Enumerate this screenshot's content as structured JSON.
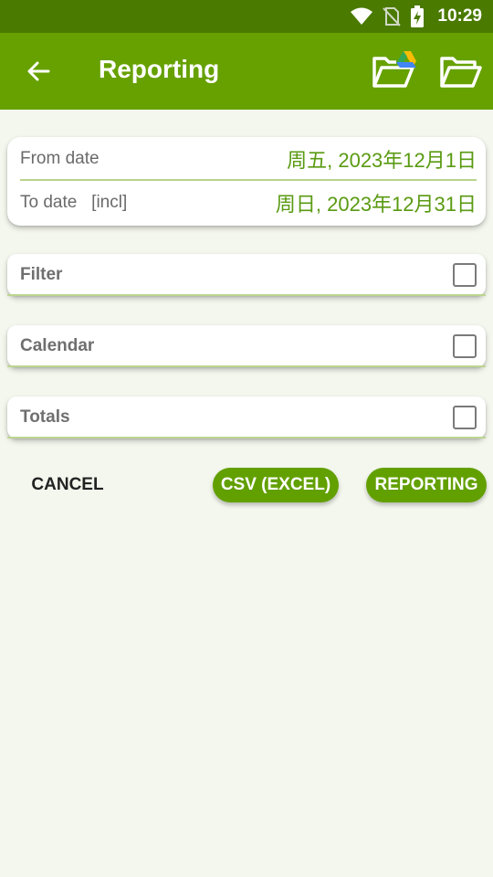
{
  "status_bar": {
    "time": "10:29",
    "icons": [
      "wifi-icon",
      "no-sim-icon",
      "battery-charging-icon"
    ]
  },
  "app_bar": {
    "title": "Reporting",
    "icons": [
      "back-arrow-icon",
      "google-drive-folder-icon",
      "folder-open-icon"
    ]
  },
  "dates": {
    "from_label": "From date",
    "from_value": "周五, 2023年12月1日",
    "to_label": "To date   [incl]",
    "to_value": "周日, 2023年12月31日"
  },
  "options": [
    {
      "label": "Filter",
      "checked": false
    },
    {
      "label": "Calendar",
      "checked": false
    },
    {
      "label": "Totals",
      "checked": false
    }
  ],
  "actions": {
    "cancel": "CANCEL",
    "csv": "CSV (EXCEL)",
    "reporting": "REPORTING"
  },
  "colors": {
    "app_bar": "#66a100",
    "status_bar": "#4a7a00",
    "accent_text": "#5a9a12",
    "button": "#62a000",
    "background": "#f4f7ee"
  }
}
